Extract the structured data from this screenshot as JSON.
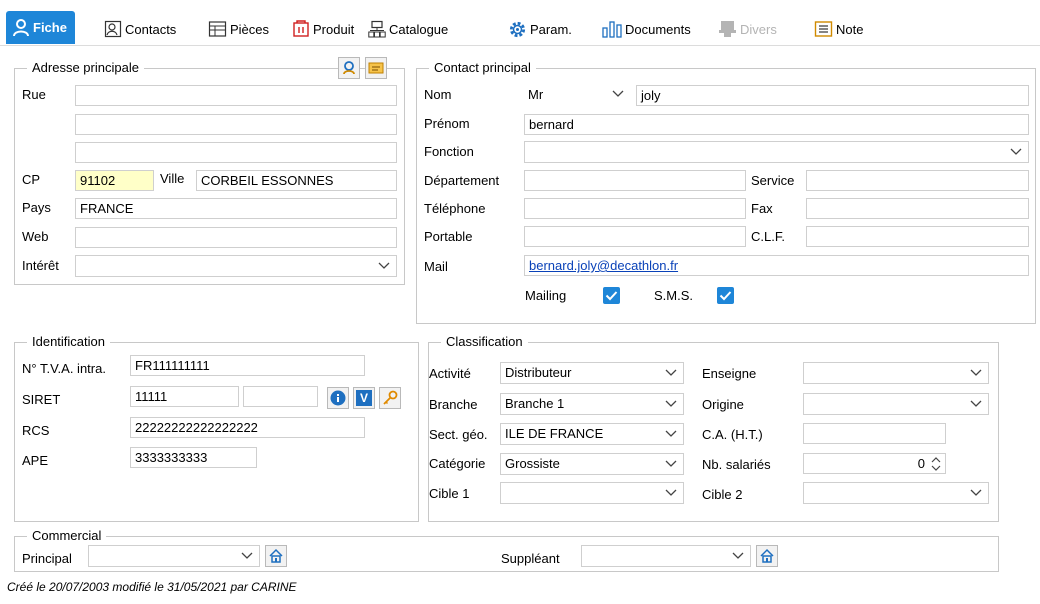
{
  "tabs": [
    {
      "label": "Fiche",
      "icon": "person-icon"
    },
    {
      "label": "Contacts",
      "icon": "contacts-icon"
    },
    {
      "label": "Pièces",
      "icon": "documents-table-icon"
    },
    {
      "label": "Produit",
      "icon": "product-icon"
    },
    {
      "label": "Catalogue",
      "icon": "catalogue-icon"
    },
    {
      "label": "Param.",
      "icon": "gear-icon"
    },
    {
      "label": "Documents",
      "icon": "bar-chart-icon"
    },
    {
      "label": "Divers",
      "icon": "misc-icon"
    },
    {
      "label": "Note",
      "icon": "note-icon"
    }
  ],
  "colors": {
    "accent": "#1e86d8",
    "yellow_field": "#ffffc8",
    "link": "#0a42b8",
    "disabled": "#b4b4b4"
  },
  "address": {
    "legend": "Adresse principale",
    "rue_label": "Rue",
    "rue1": "",
    "rue2": "",
    "rue3": "",
    "cp_label": "CP",
    "cp": "91102",
    "ville_label": "Ville",
    "ville": "CORBEIL ESSONNES",
    "pays_label": "Pays",
    "pays": "FRANCE",
    "web_label": "Web",
    "web": "",
    "interet_label": "Intérêt",
    "interet": ""
  },
  "contact": {
    "legend": "Contact principal",
    "nom_label": "Nom",
    "civilite": "Mr",
    "nom": "joly",
    "prenom_label": "Prénom",
    "prenom": "bernard",
    "fonction_label": "Fonction",
    "fonction": "",
    "departement_label": "Département",
    "departement": "",
    "service_label": "Service",
    "service": "",
    "telephone_label": "Téléphone",
    "telephone": "",
    "fax_label": "Fax",
    "fax": "",
    "portable_label": "Portable",
    "portable": "",
    "clf_label": "C.L.F.",
    "clf": "",
    "mail_label": "Mail",
    "mail": "bernard.joly@decathlon.fr",
    "mailing_label": "Mailing",
    "mailing_checked": true,
    "sms_label": "S.M.S.",
    "sms_checked": true
  },
  "identification": {
    "legend": "Identification",
    "tva_label": "N° T.V.A. intra.",
    "tva": "FR111111111",
    "siret_label": "SIRET",
    "siret1": "11111",
    "siret2": "",
    "rcs_label": "RCS",
    "rcs": "22222222222222222",
    "ape_label": "APE",
    "ape": "3333333333",
    "v_label": "V"
  },
  "classification": {
    "legend": "Classification",
    "activite_label": "Activité",
    "activite": "Distributeur",
    "enseigne_label": "Enseigne",
    "enseigne": "",
    "branche_label": "Branche",
    "branche": "Branche 1",
    "origine_label": "Origine",
    "origine": "",
    "sect_label": "Sect. géo.",
    "sect": "ILE DE FRANCE",
    "ca_label": "C.A. (H.T.)",
    "ca": "",
    "categorie_label": "Catégorie",
    "categorie": "Grossiste",
    "salaries_label": "Nb. salariés",
    "salaries": "0",
    "cible1_label": "Cible 1",
    "cible1": "",
    "cible2_label": "Cible 2",
    "cible2": ""
  },
  "commercial": {
    "legend": "Commercial",
    "principal_label": "Principal",
    "principal": "",
    "suppleant_label": "Suppléant",
    "suppleant": ""
  },
  "footer": "Créé le 20/07/2003 modifié le 31/05/2021 par CARINE"
}
